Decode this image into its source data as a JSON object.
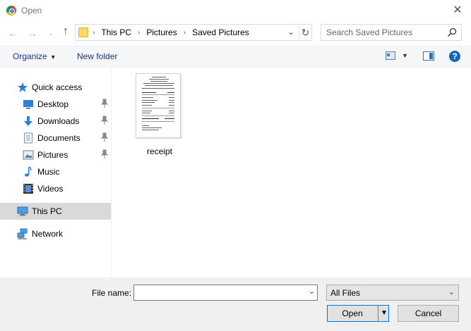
{
  "window": {
    "title": "Open",
    "app_icon": "chrome-icon",
    "close_glyph": "✕"
  },
  "nav": {
    "back_glyph": "←",
    "forward_glyph": "→",
    "recent_glyph": "⌄",
    "up_glyph": "↑"
  },
  "address": {
    "crumbs": [
      "This PC",
      "Pictures",
      "Saved Pictures"
    ],
    "sep_glyph": "›",
    "dropdown_glyph": "⌄",
    "refresh_glyph": "↻"
  },
  "search": {
    "placeholder": "Search Saved Pictures"
  },
  "toolbar": {
    "organize_label": "Organize",
    "organize_caret": "▼",
    "new_folder_label": "New folder",
    "view_caret": "▼",
    "help_label": "?"
  },
  "sidebar": {
    "items": [
      {
        "label": "Quick access",
        "icon": "star-icon"
      },
      {
        "label": "Desktop",
        "icon": "desktop-icon",
        "pinned": true
      },
      {
        "label": "Downloads",
        "icon": "download-icon",
        "pinned": true
      },
      {
        "label": "Documents",
        "icon": "documents-icon",
        "pinned": true
      },
      {
        "label": "Pictures",
        "icon": "pictures-icon",
        "pinned": true
      },
      {
        "label": "Music",
        "icon": "music-icon"
      },
      {
        "label": "Videos",
        "icon": "videos-icon"
      },
      {
        "label": "This PC",
        "icon": "computer-icon",
        "selected": true
      },
      {
        "label": "Network",
        "icon": "network-icon"
      }
    ],
    "pin_glyph": "📌"
  },
  "files": [
    {
      "name": "receipt",
      "type": "image"
    }
  ],
  "footer": {
    "file_name_label": "File name:",
    "file_name_value": "",
    "file_type_value": "All Files",
    "open_label": "Open",
    "cancel_label": "Cancel",
    "caret_glyph": "⌄"
  },
  "colors": {
    "accent_blue": "#0078d7",
    "link_blue": "#1e3287",
    "selected_bg": "#d9d9d9",
    "footer_bg": "#f0f0f0"
  }
}
